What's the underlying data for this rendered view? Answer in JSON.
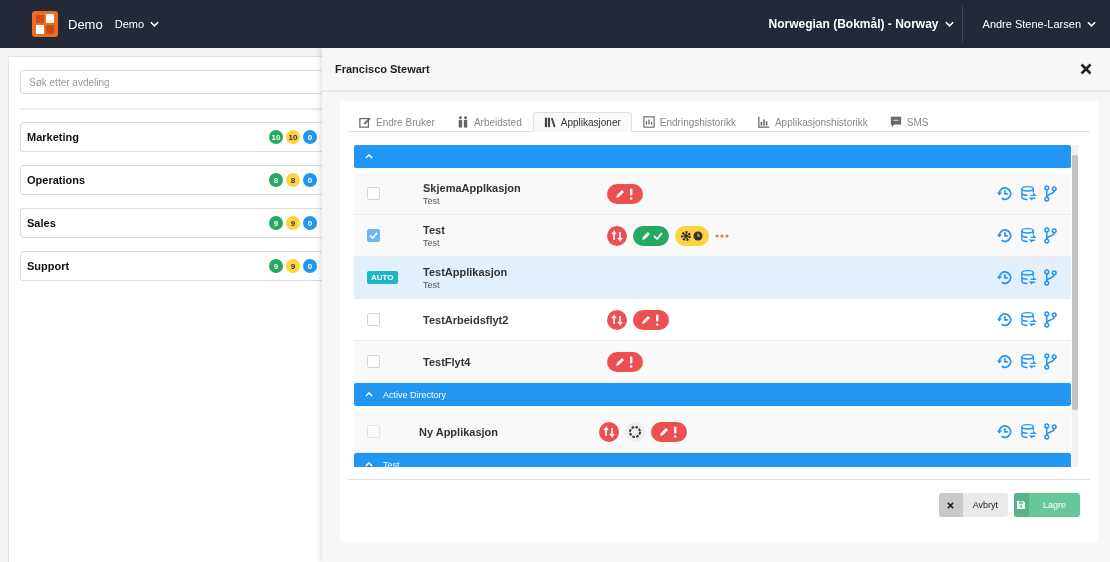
{
  "header": {
    "brand": "Demo",
    "workspace": "Demo",
    "language": "Norwegian (Bokmål) - Norway",
    "user": "Andre Stene-Larsen"
  },
  "departments": {
    "search": {
      "placeholder": "Søk etter avdeling"
    },
    "items": [
      {
        "name": "Marketing",
        "counts": [
          {
            "value": "10",
            "color": "#27a961"
          },
          {
            "value": "10",
            "color": "#fdd43f"
          },
          {
            "value": "0",
            "color": "#2196f3"
          }
        ]
      },
      {
        "name": "Operations",
        "counts": [
          {
            "value": "8",
            "color": "#27a961"
          },
          {
            "value": "8",
            "color": "#fdd43f"
          },
          {
            "value": "0",
            "color": "#2196f3"
          }
        ]
      },
      {
        "name": "Sales",
        "counts": [
          {
            "value": "9",
            "color": "#27a961"
          },
          {
            "value": "9",
            "color": "#fdd43f"
          },
          {
            "value": "0",
            "color": "#2196f3"
          }
        ]
      },
      {
        "name": "Support",
        "counts": [
          {
            "value": "9",
            "color": "#27a961"
          },
          {
            "value": "9",
            "color": "#fdd43f"
          },
          {
            "value": "0",
            "color": "#2196f3"
          }
        ]
      }
    ]
  },
  "dialog": {
    "title": "Francisco Stewart",
    "tabs": [
      {
        "label": "Endre Bruker",
        "kind": "edit",
        "selected": false
      },
      {
        "label": "Arbeidsted",
        "kind": "people",
        "selected": false
      },
      {
        "label": "Applikasjoner",
        "kind": "books",
        "selected": true
      },
      {
        "label": "Endringshistorikk",
        "kind": "frame",
        "selected": false
      },
      {
        "label": "Applikasjonshistorikk",
        "kind": "chart",
        "selected": false
      },
      {
        "label": "SMS",
        "kind": "chat",
        "selected": false
      }
    ],
    "groups": [
      {
        "expanded": true,
        "rows": [
          {
            "kind": "checkbox",
            "name": "SkjemaApplkasjon",
            "subtitle": "Test",
            "checked": false,
            "selected": false,
            "statuses": [
              {
                "kind": "edit-alert"
              }
            ]
          },
          {
            "kind": "checkbox",
            "name": "Test",
            "subtitle": "Test",
            "checked": true,
            "selected": false,
            "statuses": [
              {
                "kind": "sync"
              },
              {
                "kind": "edit-ok"
              },
              {
                "kind": "gear-clock"
              },
              {
                "kind": "more"
              }
            ]
          },
          {
            "kind": "auto",
            "badge": "AUTO",
            "name": "TestApplikasjon",
            "subtitle": "Test",
            "selected": true
          },
          {
            "kind": "checkbox",
            "name": "TestArbeidsflyt2",
            "checked": false,
            "selected": false,
            "statuses": [
              {
                "kind": "sync"
              },
              {
                "kind": "edit-alert"
              }
            ]
          },
          {
            "kind": "checkbox",
            "name": "TestFlyt4",
            "checked": false,
            "selected": false,
            "statuses": [
              {
                "kind": "edit-alert"
              }
            ]
          }
        ]
      },
      {
        "title": "Active Directory",
        "expanded": true,
        "rows": [
          {
            "kind": "checkbox",
            "name": "Ny Applikasjon",
            "checked": false,
            "disabled": true,
            "selected": false,
            "statuses": [
              {
                "kind": "sync"
              },
              {
                "kind": "spinner"
              },
              {
                "kind": "edit-alert"
              }
            ]
          }
        ]
      },
      {
        "title": "Test",
        "expanded": true
      }
    ],
    "cancel": "Avbryt",
    "save": "Lagre",
    "save_disabled": true
  }
}
